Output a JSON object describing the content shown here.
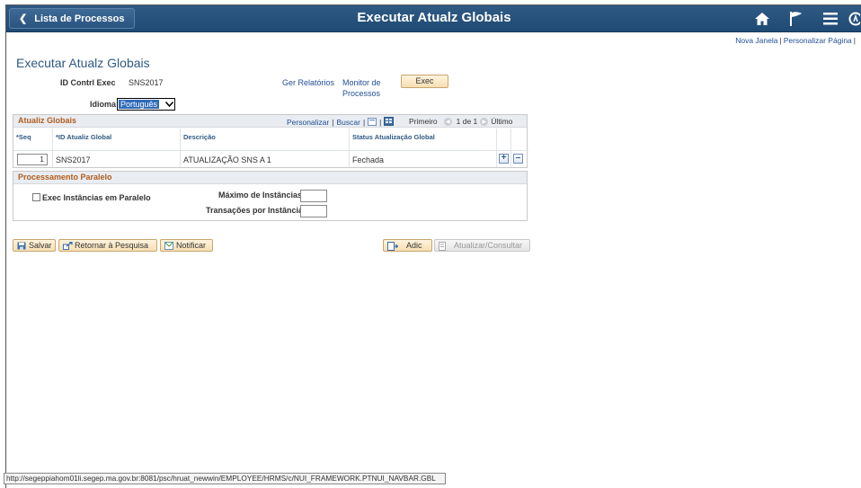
{
  "header": {
    "back_label": "Lista de Processos",
    "title": "Executar Atualz Globais"
  },
  "top_links": {
    "new_window": "Nova Janela",
    "personalize_page": "Personalizar Página",
    "separator": "|"
  },
  "page_title": "Executar Atualz Globais",
  "run_control": {
    "id_label": "ID Contrl Exec",
    "id_value": "SNS2017",
    "language_label": "Idioma",
    "language_value": "Português",
    "report_manager": "Ger Relatórios",
    "process_monitor_line1": "Monitor de",
    "process_monitor_line2": "Processos",
    "run_button": "Exec"
  },
  "updates_grid": {
    "title": "Atualiz Globais",
    "personalize": "Personalizar",
    "find": "Buscar",
    "first": "Primeiro",
    "range": "1 de 1",
    "last": "Último",
    "columns": [
      "*Seq",
      "*ID Atualiz Global",
      "Descrição",
      "Status Atualização Global"
    ],
    "rows": [
      {
        "seq": "1",
        "id": "SNS2017",
        "description": "ATUALIZAÇÃO SNS A 1",
        "status": "Fechada"
      }
    ]
  },
  "parallel": {
    "title": "Processamento Paralelo",
    "checkbox_label": "Exec Instâncias em Paralelo",
    "checked": false,
    "max_instances_label": "Máximo de Instâncias",
    "transactions_label": "Transações por Instância"
  },
  "toolbar": {
    "save": "Salvar",
    "return_search": "Retornar à Pesquisa",
    "notify": "Notificar",
    "add": "Adic",
    "update_display": "Atualizar/Consultar"
  },
  "status_url": "http://segeppiahom01li.segep.ma.gov.br:8081/psc/hruat_newwin/EMPLOYEE/HRMS/c/NUI_FRAMEWORK.PTNUI_NAVBAR.GBL",
  "colors": {
    "banner": "#2f5a84",
    "link": "#1f4e96",
    "section_title": "#b05d1e"
  }
}
